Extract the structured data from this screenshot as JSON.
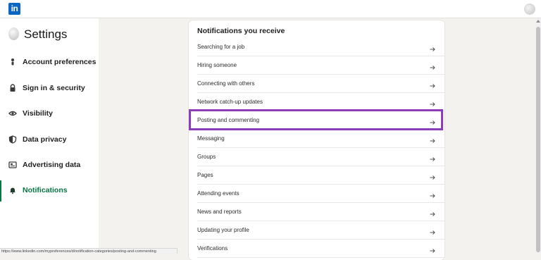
{
  "topbar": {
    "logo_text": "in"
  },
  "sidebar": {
    "title": "Settings",
    "items": [
      {
        "label": "Account preferences",
        "icon": "person-icon"
      },
      {
        "label": "Sign in & security",
        "icon": "lock-icon"
      },
      {
        "label": "Visibility",
        "icon": "eye-icon"
      },
      {
        "label": "Data privacy",
        "icon": "shield-icon"
      },
      {
        "label": "Advertising data",
        "icon": "newspaper-icon"
      },
      {
        "label": "Notifications",
        "icon": "bell-icon",
        "active": true
      }
    ]
  },
  "main": {
    "title": "Notifications you receive",
    "rows": [
      {
        "label": "Searching for a job"
      },
      {
        "label": "Hiring someone"
      },
      {
        "label": "Connecting with others"
      },
      {
        "label": "Network catch-up updates"
      },
      {
        "label": "Posting and commenting",
        "highlighted": true
      },
      {
        "label": "Messaging"
      },
      {
        "label": "Groups"
      },
      {
        "label": "Pages"
      },
      {
        "label": "Attending events"
      },
      {
        "label": "News and reports"
      },
      {
        "label": "Updating your profile"
      },
      {
        "label": "Verifications"
      }
    ]
  },
  "status_url": "https://www.linkedin.com/mypreferences/d/notification-categories/posting-and-commenting",
  "colors": {
    "brand": "#0a66c2",
    "active_nav": "#057642",
    "highlight_border": "#8a3fb8",
    "background": "#f4f2ee"
  }
}
